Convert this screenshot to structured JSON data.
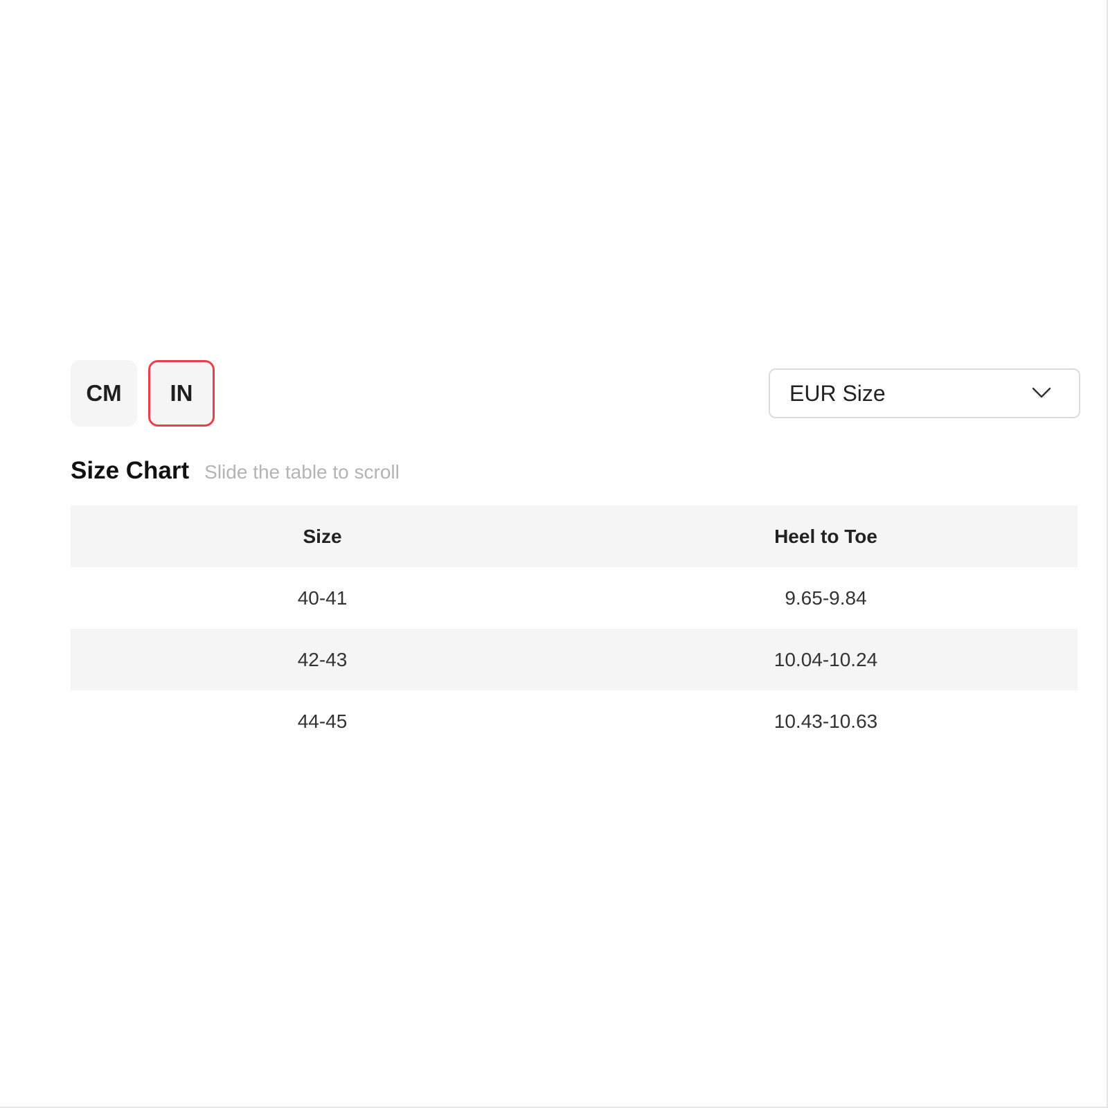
{
  "unit_toggle": {
    "options": [
      "CM",
      "IN"
    ],
    "selected": "IN"
  },
  "size_select": {
    "selected": "EUR Size"
  },
  "heading": {
    "title": "Size Chart",
    "hint": "Slide the table to scroll"
  },
  "table": {
    "headers": [
      "Size",
      "Heel to Toe"
    ],
    "rows": [
      [
        "40-41",
        "9.65-9.84"
      ],
      [
        "42-43",
        "10.04-10.24"
      ],
      [
        "44-45",
        "10.43-10.63"
      ]
    ]
  },
  "colors": {
    "accent": "#e8404b",
    "row_stripe": "#f5f5f5"
  }
}
